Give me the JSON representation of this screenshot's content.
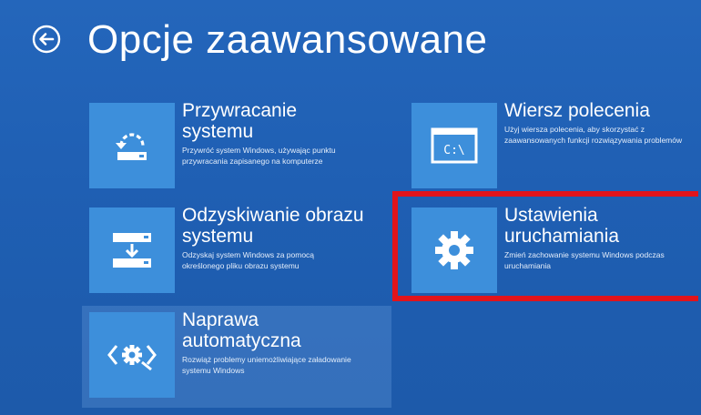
{
  "header": {
    "title": "Opcje zaawansowane",
    "back_icon": "back-arrow-circle-icon"
  },
  "tiles": [
    {
      "id": "system-restore",
      "title": "Przywracanie systemu",
      "description": "Przywróć system Windows, używając punktu przywracania zapisanego na komputerze",
      "icon": "system-restore-icon"
    },
    {
      "id": "command-prompt",
      "title": "Wiersz polecenia",
      "description": "Użyj wiersza polecenia, aby skorzystać z zaawansowanych funkcji rozwiązywania problemów",
      "icon": "command-prompt-icon",
      "icon_text": "C:\\"
    },
    {
      "id": "image-recovery",
      "title": "Odzyskiwanie obrazu systemu",
      "description": "Odzyskaj system Windows za pomocą określonego pliku obrazu systemu",
      "icon": "system-image-recovery-icon"
    },
    {
      "id": "startup-settings",
      "title": "Ustawienia uruchamiania",
      "description": "Zmień zachowanie systemu Windows podczas uruchamiania",
      "icon": "gear-icon",
      "highlighted": true
    },
    {
      "id": "startup-repair",
      "title": "Naprawa automatyczna",
      "description": "Rozwiąż problemy uniemożliwiające załadowanie systemu Windows",
      "icon": "startup-repair-icon",
      "selected": true
    }
  ],
  "colors": {
    "background": "#1f5fb3",
    "tile_icon_background": "#3d8fdb",
    "highlight_border": "#e1141b"
  }
}
